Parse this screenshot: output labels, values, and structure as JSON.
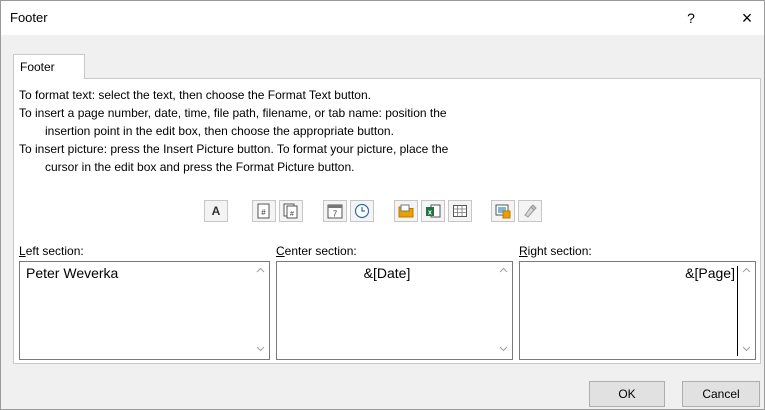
{
  "dialog": {
    "title": "Footer",
    "help_label": "?",
    "close_label": "×"
  },
  "tab": {
    "label": "Footer"
  },
  "instructions": [
    "To format text:  select the text, then choose the Format Text button.",
    "To insert a page number, date, time, file path, filename, or tab name:  position the",
    "insertion point in the edit box, then choose the appropriate button.",
    "To insert picture: press the Insert Picture button.  To format your picture, place the",
    "cursor in the edit box and press the Format Picture button."
  ],
  "toolbar": {
    "format_text_glyph": "A",
    "icons": [
      "format-text-icon",
      "insert-page-number-icon",
      "insert-number-of-pages-icon",
      "insert-date-icon",
      "insert-time-icon",
      "insert-file-path-icon",
      "insert-file-name-icon",
      "insert-sheet-name-icon",
      "insert-picture-icon",
      "format-picture-icon"
    ]
  },
  "sections": {
    "left": {
      "label_key": "L",
      "label_rest": "eft section:",
      "text": "Peter Weverka"
    },
    "center": {
      "label_key": "C",
      "label_rest": "enter section:",
      "text": "&[Date]"
    },
    "right": {
      "label_key": "R",
      "label_rest": "ight section:",
      "text": "&[Page]"
    }
  },
  "buttons": {
    "ok": "OK",
    "cancel": "Cancel"
  },
  "colors": {
    "dialog_bg": "#f0f0f0",
    "panel_bg": "#ffffff",
    "border": "#7a7a7a",
    "icon_orange": "#e8a100",
    "icon_green": "#217346",
    "icon_blue": "#2b6cb0"
  }
}
